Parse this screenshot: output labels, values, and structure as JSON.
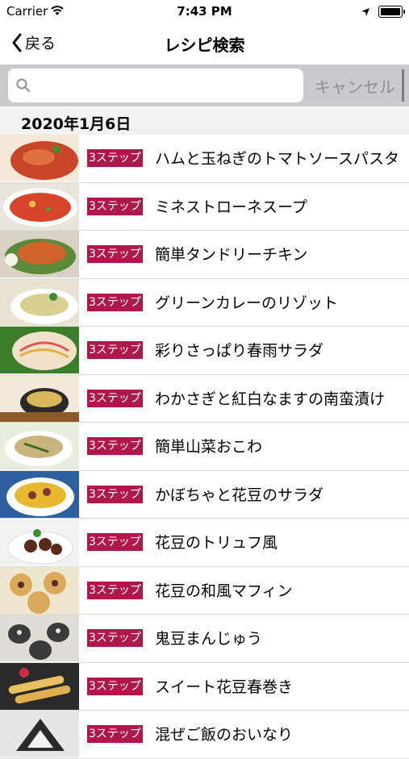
{
  "status": {
    "carrier": "Carrier",
    "time": "7:43 PM"
  },
  "nav": {
    "back_label": "戻る",
    "title": "レシピ検索"
  },
  "search": {
    "placeholder": "",
    "value": "",
    "cancel_label": "キャンセル"
  },
  "section_header": "2020年1月6日",
  "recipes": [
    {
      "badge": "3ステップ",
      "title": "ハムと玉ねぎのトマトソースパスタ"
    },
    {
      "badge": "3ステップ",
      "title": "ミネストローネスープ"
    },
    {
      "badge": "3ステップ",
      "title": "簡単タンドリーチキン"
    },
    {
      "badge": "3ステップ",
      "title": "グリーンカレーのリゾット"
    },
    {
      "badge": "3ステップ",
      "title": "彩りさっぱり春雨サラダ"
    },
    {
      "badge": "3ステップ",
      "title": "わかさぎと紅白なますの南蛮漬け"
    },
    {
      "badge": "3ステップ",
      "title": "簡単山菜おこわ"
    },
    {
      "badge": "3ステップ",
      "title": "かぼちゃと花豆のサラダ"
    },
    {
      "badge": "3ステップ",
      "title": "花豆のトリュフ風"
    },
    {
      "badge": "3ステップ",
      "title": "花豆の和風マフィン"
    },
    {
      "badge": "3ステップ",
      "title": "鬼豆まんじゅう"
    },
    {
      "badge": "3ステップ",
      "title": "スイート花豆春巻き"
    },
    {
      "badge": "3ステップ",
      "title": "混ぜご飯のおいなり"
    }
  ],
  "colors": {
    "badge": "#b0174b",
    "searchbar_bg": "#c9c9ce",
    "section_bg": "#f2f2f2"
  },
  "icons": {
    "back": "chevron-left-icon",
    "search": "magnifier-icon",
    "wifi": "wifi-icon",
    "location": "location-arrow-icon",
    "battery": "battery-icon"
  }
}
